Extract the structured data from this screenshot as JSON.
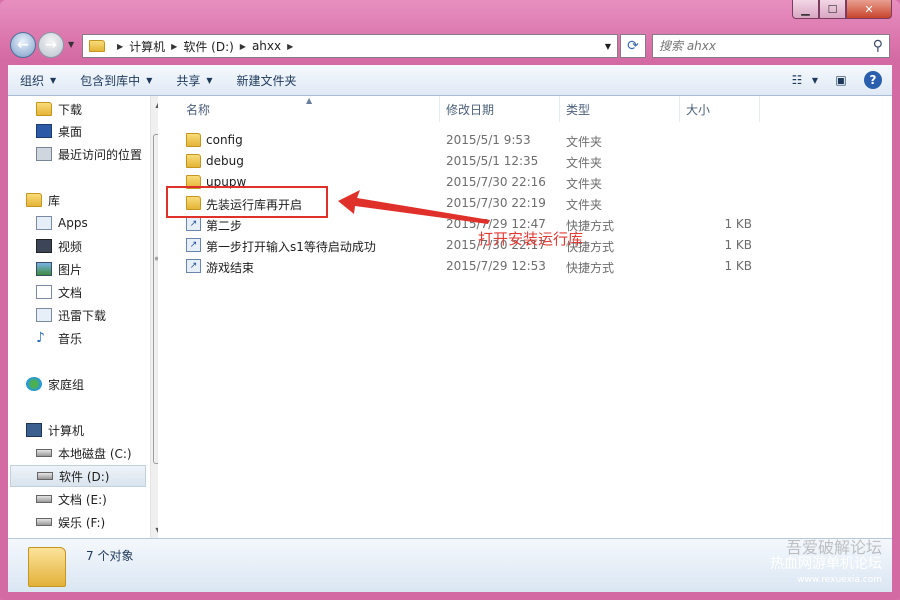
{
  "address": {
    "crumbs": [
      "计算机",
      "软件 (D:)",
      "ahxx"
    ]
  },
  "search": {
    "placeholder": "搜索 ahxx"
  },
  "toolbar": {
    "organize": "组织",
    "include_library": "包含到库中",
    "share": "共享",
    "new_folder": "新建文件夹"
  },
  "sidebar": {
    "items": [
      {
        "label": "下载",
        "icon": "download-folder-icon"
      },
      {
        "label": "桌面",
        "icon": "desktop-icon"
      },
      {
        "label": "最近访问的位置",
        "icon": "recent-places-icon"
      },
      {
        "label": "库",
        "icon": "library-icon"
      },
      {
        "label": "Apps",
        "icon": "library-folder-icon"
      },
      {
        "label": "视频",
        "icon": "video-icon"
      },
      {
        "label": "图片",
        "icon": "picture-icon"
      },
      {
        "label": "文档",
        "icon": "document-icon"
      },
      {
        "label": "迅雷下载",
        "icon": "library-folder-icon"
      },
      {
        "label": "音乐",
        "icon": "music-icon"
      },
      {
        "label": "家庭组",
        "icon": "homegroup-icon"
      },
      {
        "label": "计算机",
        "icon": "computer-icon"
      },
      {
        "label": "本地磁盘 (C:)",
        "icon": "drive-icon"
      },
      {
        "label": "软件 (D:)",
        "icon": "drive-icon"
      },
      {
        "label": "文档 (E:)",
        "icon": "drive-icon"
      },
      {
        "label": "娱乐 (F:)",
        "icon": "drive-icon"
      }
    ]
  },
  "columns": {
    "name": "名称",
    "date": "修改日期",
    "type": "类型",
    "size": "大小"
  },
  "files": [
    {
      "name": "config",
      "date": "2015/5/1 9:53",
      "type": "文件夹",
      "size": "",
      "icon": "folder-icon"
    },
    {
      "name": "debug",
      "date": "2015/5/1 12:35",
      "type": "文件夹",
      "size": "",
      "icon": "folder-icon"
    },
    {
      "name": "upupw",
      "date": "2015/7/30 22:16",
      "type": "文件夹",
      "size": "",
      "icon": "folder-icon"
    },
    {
      "name": "先装运行库再开启",
      "date": "2015/7/30 22:19",
      "type": "文件夹",
      "size": "",
      "icon": "folder-icon"
    },
    {
      "name": "第二步",
      "date": "2015/7/29 12:47",
      "type": "快捷方式",
      "size": "1 KB",
      "icon": "shortcut-icon"
    },
    {
      "name": "第一步打开输入s1等待启动成功",
      "date": "2015/7/30 22:17",
      "type": "快捷方式",
      "size": "1 KB",
      "icon": "shortcut-icon"
    },
    {
      "name": "游戏结束",
      "date": "2015/7/29 12:53",
      "type": "快捷方式",
      "size": "1 KB",
      "icon": "shortcut-icon"
    }
  ],
  "annotation": {
    "text": "打开安装运行库",
    "color": "#e0302a"
  },
  "status": {
    "count": "7 个对象"
  },
  "watermark": {
    "line1": "吾爱破解论坛",
    "line2": "热血网游单机论坛",
    "line3": "www.rexuexia.com"
  }
}
